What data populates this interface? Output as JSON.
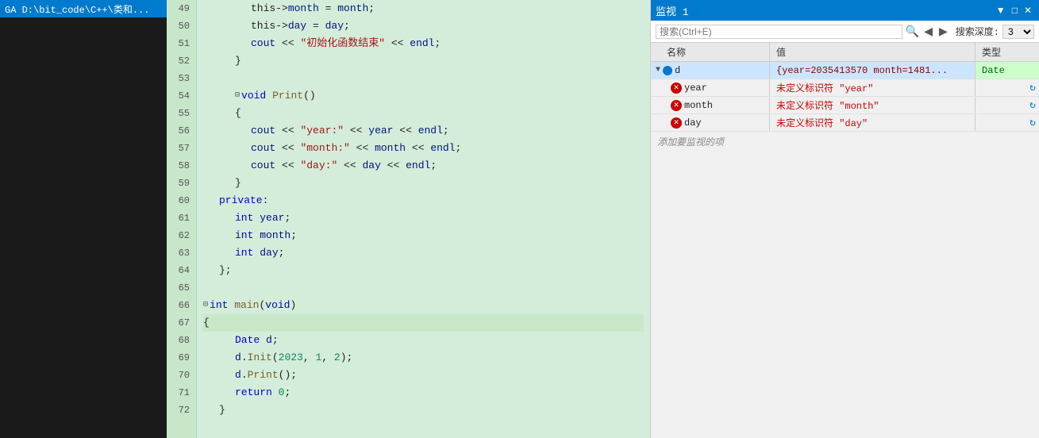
{
  "sidebar": {
    "title": "GA D:\\bit_code\\C++\\类和..."
  },
  "editor": {
    "lines": [
      {
        "num": 49,
        "indent": 3,
        "content": "this->month = month;",
        "tokens": [
          {
            "t": "plain",
            "v": "this->"
          },
          {
            "t": "var",
            "v": "month"
          },
          {
            "t": "plain",
            "v": " = "
          },
          {
            "t": "var",
            "v": "month"
          },
          {
            "t": "plain",
            "v": ";"
          }
        ]
      },
      {
        "num": 50,
        "indent": 3,
        "content": "this->day = day;",
        "tokens": [
          {
            "t": "plain",
            "v": "this->"
          },
          {
            "t": "var",
            "v": "day"
          },
          {
            "t": "plain",
            "v": " = "
          },
          {
            "t": "var",
            "v": "day"
          },
          {
            "t": "plain",
            "v": ";"
          }
        ]
      },
      {
        "num": 51,
        "indent": 3,
        "content": "cout << \"初始化函数结束\" << endl;",
        "tokens": [
          {
            "t": "var",
            "v": "cout"
          },
          {
            "t": "plain",
            "v": " << "
          },
          {
            "t": "str",
            "v": "\"初始化函数结束\""
          },
          {
            "t": "plain",
            "v": " << "
          },
          {
            "t": "var",
            "v": "endl"
          },
          {
            "t": "plain",
            "v": ";"
          }
        ]
      },
      {
        "num": 52,
        "indent": 2,
        "content": "}",
        "tokens": [
          {
            "t": "plain",
            "v": "}"
          }
        ]
      },
      {
        "num": 53,
        "indent": 0,
        "content": "",
        "tokens": []
      },
      {
        "num": 54,
        "indent": 2,
        "content": "void Print()",
        "tokens": [
          {
            "t": "kw",
            "v": "void"
          },
          {
            "t": "plain",
            "v": " "
          },
          {
            "t": "fn",
            "v": "Print"
          },
          {
            "t": "plain",
            "v": "()"
          }
        ],
        "fold": true
      },
      {
        "num": 55,
        "indent": 2,
        "content": "{",
        "tokens": [
          {
            "t": "plain",
            "v": "{"
          }
        ]
      },
      {
        "num": 56,
        "indent": 3,
        "content": "cout << \"year:\" << year << endl;",
        "tokens": [
          {
            "t": "var",
            "v": "cout"
          },
          {
            "t": "plain",
            "v": " << "
          },
          {
            "t": "str",
            "v": "\"year:\""
          },
          {
            "t": "plain",
            "v": " << "
          },
          {
            "t": "var",
            "v": "year"
          },
          {
            "t": "plain",
            "v": " << "
          },
          {
            "t": "var",
            "v": "endl"
          },
          {
            "t": "plain",
            "v": ";"
          }
        ]
      },
      {
        "num": 57,
        "indent": 3,
        "content": "cout << \"month:\" << month << endl;",
        "tokens": [
          {
            "t": "var",
            "v": "cout"
          },
          {
            "t": "plain",
            "v": " << "
          },
          {
            "t": "str",
            "v": "\"month:\""
          },
          {
            "t": "plain",
            "v": " << "
          },
          {
            "t": "var",
            "v": "month"
          },
          {
            "t": "plain",
            "v": " << "
          },
          {
            "t": "var",
            "v": "endl"
          },
          {
            "t": "plain",
            "v": ";"
          }
        ]
      },
      {
        "num": 58,
        "indent": 3,
        "content": "cout << \"day:\" << day << endl;",
        "tokens": [
          {
            "t": "var",
            "v": "cout"
          },
          {
            "t": "plain",
            "v": " << "
          },
          {
            "t": "str",
            "v": "\"day:\""
          },
          {
            "t": "plain",
            "v": " << "
          },
          {
            "t": "var",
            "v": "day"
          },
          {
            "t": "plain",
            "v": " << "
          },
          {
            "t": "var",
            "v": "endl"
          },
          {
            "t": "plain",
            "v": ";"
          }
        ]
      },
      {
        "num": 59,
        "indent": 2,
        "content": "}",
        "tokens": [
          {
            "t": "plain",
            "v": "}"
          }
        ]
      },
      {
        "num": 60,
        "indent": 1,
        "content": "private:",
        "tokens": [
          {
            "t": "kw",
            "v": "private"
          },
          {
            "t": "plain",
            "v": ":"
          }
        ]
      },
      {
        "num": 61,
        "indent": 2,
        "content": "int year;",
        "tokens": [
          {
            "t": "kw",
            "v": "int"
          },
          {
            "t": "plain",
            "v": " "
          },
          {
            "t": "var",
            "v": "year"
          },
          {
            "t": "plain",
            "v": ";"
          }
        ]
      },
      {
        "num": 62,
        "indent": 2,
        "content": "int month;",
        "tokens": [
          {
            "t": "kw",
            "v": "int"
          },
          {
            "t": "plain",
            "v": " "
          },
          {
            "t": "var",
            "v": "month"
          },
          {
            "t": "plain",
            "v": ";"
          }
        ]
      },
      {
        "num": 63,
        "indent": 2,
        "content": "int day;",
        "tokens": [
          {
            "t": "kw",
            "v": "int"
          },
          {
            "t": "plain",
            "v": " "
          },
          {
            "t": "var",
            "v": "day"
          },
          {
            "t": "plain",
            "v": ";"
          }
        ]
      },
      {
        "num": 64,
        "indent": 1,
        "content": "};",
        "tokens": [
          {
            "t": "plain",
            "v": "};"
          }
        ]
      },
      {
        "num": 65,
        "indent": 0,
        "content": "",
        "tokens": []
      },
      {
        "num": 66,
        "indent": 0,
        "content": "int main(void)",
        "tokens": [
          {
            "t": "kw",
            "v": "int"
          },
          {
            "t": "plain",
            "v": " "
          },
          {
            "t": "fn",
            "v": "main"
          },
          {
            "t": "plain",
            "v": "("
          },
          {
            "t": "kw",
            "v": "void"
          },
          {
            "t": "plain",
            "v": ")"
          }
        ],
        "fold": true
      },
      {
        "num": 67,
        "indent": 0,
        "content": "{",
        "tokens": [
          {
            "t": "plain",
            "v": "{"
          }
        ],
        "arrow": true
      },
      {
        "num": 68,
        "indent": 2,
        "content": "Date d;",
        "tokens": [
          {
            "t": "type",
            "v": "Date"
          },
          {
            "t": "plain",
            "v": " "
          },
          {
            "t": "var",
            "v": "d"
          },
          {
            "t": "plain",
            "v": ";"
          }
        ]
      },
      {
        "num": 69,
        "indent": 2,
        "content": "d.Init(2023, 1, 2);",
        "tokens": [
          {
            "t": "var",
            "v": "d"
          },
          {
            "t": "plain",
            "v": "."
          },
          {
            "t": "fn",
            "v": "Init"
          },
          {
            "t": "plain",
            "v": "("
          },
          {
            "t": "num",
            "v": "2023"
          },
          {
            "t": "plain",
            "v": ", "
          },
          {
            "t": "num",
            "v": "1"
          },
          {
            "t": "plain",
            "v": ", "
          },
          {
            "t": "num",
            "v": "2"
          },
          {
            "t": "plain",
            "v": ");"
          }
        ]
      },
      {
        "num": 70,
        "indent": 2,
        "content": "d.Print();",
        "tokens": [
          {
            "t": "var",
            "v": "d"
          },
          {
            "t": "plain",
            "v": "."
          },
          {
            "t": "fn",
            "v": "Print"
          },
          {
            "t": "plain",
            "v": "();"
          }
        ]
      },
      {
        "num": 71,
        "indent": 2,
        "content": "return 0;",
        "tokens": [
          {
            "t": "kw",
            "v": "return"
          },
          {
            "t": "plain",
            "v": " "
          },
          {
            "t": "num",
            "v": "0"
          },
          {
            "t": "plain",
            "v": ";"
          }
        ]
      },
      {
        "num": 72,
        "indent": 1,
        "content": "}",
        "tokens": [
          {
            "t": "plain",
            "v": "}"
          }
        ]
      }
    ]
  },
  "watch": {
    "title": "监视 1",
    "search_placeholder": "搜索(Ctrl+E)",
    "search_depth_label": "搜索深度:",
    "search_depth_value": "3",
    "nav_back": "◀",
    "nav_fwd": "▶",
    "col_name": "名称",
    "col_value": "值",
    "col_type": "类型",
    "rows": [
      {
        "name": "d",
        "icon": "dot",
        "value": "{year=2035413570 month=1481...",
        "type": "Date",
        "type_highlight": true,
        "expandable": true,
        "selected": true
      },
      {
        "name": "year",
        "icon": "error",
        "value": "未定义标识符 \"year\"",
        "type": "",
        "type_highlight": false,
        "indented": true
      },
      {
        "name": "month",
        "icon": "error",
        "value": "未定义标识符 \"month\"",
        "type": "",
        "type_highlight": false,
        "indented": true
      },
      {
        "name": "day",
        "icon": "error",
        "value": "未定义标识符 \"day\"",
        "type": "",
        "type_highlight": false,
        "indented": true
      }
    ],
    "add_watch_label": "添加要监视的项"
  }
}
